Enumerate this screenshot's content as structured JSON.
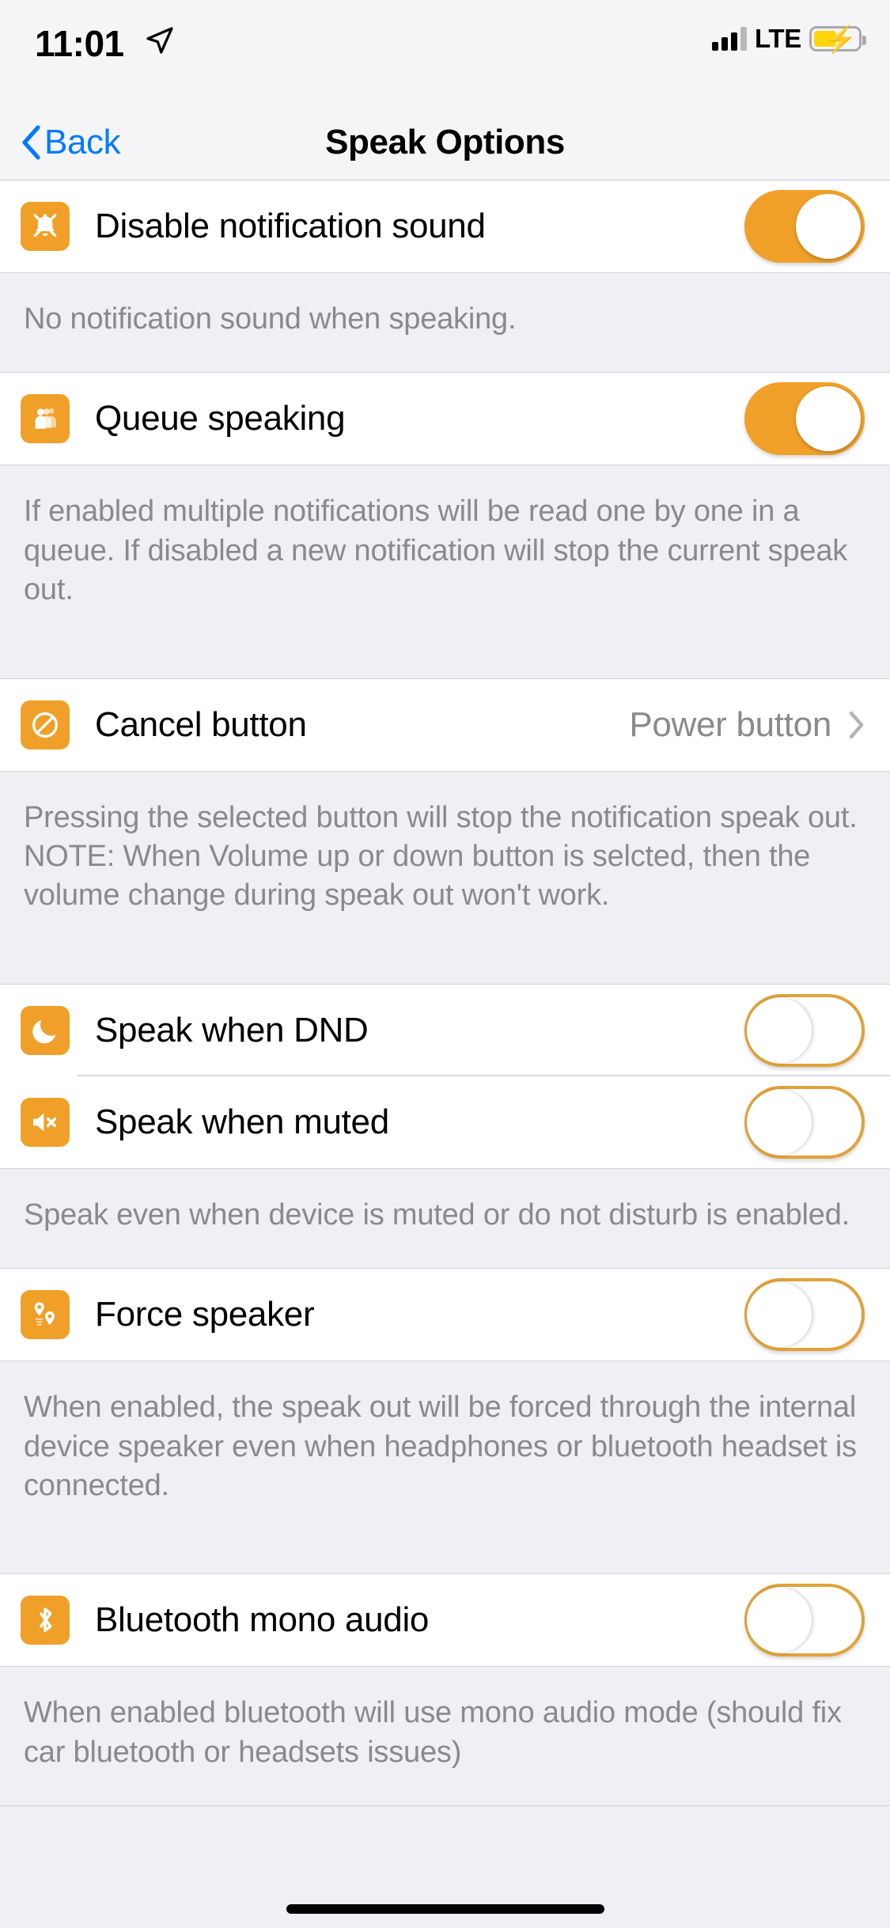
{
  "status_bar": {
    "time": "11:01",
    "location_icon": "location-arrow-icon",
    "signal_icon": "cellular-signal-icon",
    "carrier": "LTE",
    "battery_icon": "battery-charging-icon",
    "battery_level_pct": 52
  },
  "nav": {
    "back_label": "Back",
    "back_icon": "chevron-left-icon",
    "title": "Speak Options"
  },
  "accent_color": "#F0A029",
  "link_color": "#007AFF",
  "sections": [
    {
      "rows": [
        {
          "label": "Disable notification sound",
          "icon": "bell-slash-icon",
          "control": "switch",
          "state": "on"
        }
      ],
      "footer": "No notification sound when speaking."
    },
    {
      "rows": [
        {
          "label": "Queue speaking",
          "icon": "people-queue-icon",
          "control": "switch",
          "state": "on"
        }
      ],
      "footer": "If enabled multiple notifications will be read one by one in a queue. If disabled a new notification will stop the current speak out."
    },
    {
      "rows": [
        {
          "label": "Cancel button",
          "icon": "prohibited-circle-icon",
          "control": "disclosure",
          "value": "Power button",
          "chevron": "chevron-right-icon"
        }
      ],
      "footer": "Pressing the selected button will stop the notification speak out.\nNOTE: When Volume up or down button is selcted, then the volume change during speak out won't work."
    },
    {
      "rows": [
        {
          "label": "Speak when DND",
          "icon": "moon-icon",
          "control": "switch",
          "state": "off"
        },
        {
          "label": "Speak when muted",
          "icon": "speaker-mute-icon",
          "control": "switch",
          "state": "off"
        }
      ],
      "footer": "Speak even when device is muted or do not disturb is enabled."
    },
    {
      "rows": [
        {
          "label": "Force speaker",
          "icon": "map-pins-icon",
          "control": "switch",
          "state": "off"
        }
      ],
      "footer": "When enabled, the speak out will be forced through the internal device speaker even when headphones or bluetooth headset is connected."
    },
    {
      "rows": [
        {
          "label": "Bluetooth mono audio",
          "icon": "bluetooth-icon",
          "control": "switch",
          "state": "off"
        }
      ],
      "footer": "When enabled bluetooth will use mono audio mode (should fix car bluetooth or headsets issues)"
    }
  ]
}
